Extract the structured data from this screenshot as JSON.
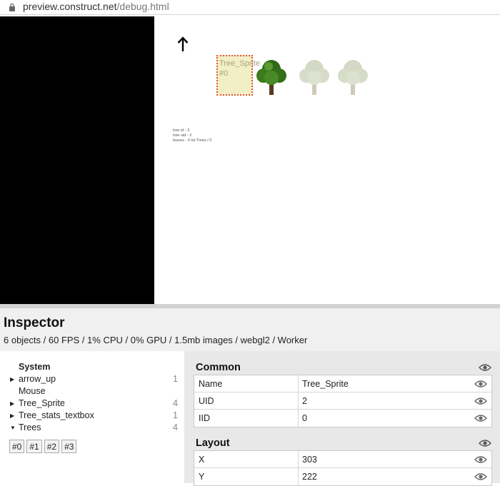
{
  "address_bar": {
    "host": "preview.construct.net",
    "path": "/debug.html"
  },
  "viewport": {
    "selected_sprite": {
      "name": "Tree_Sprite",
      "iid": "#0"
    },
    "stats_lines": [
      "tree id - 3",
      "tree uid - 2",
      "leaves - 0 tot Trees / 0"
    ]
  },
  "inspector": {
    "title": "Inspector",
    "stats": "6 objects / 60 FPS / 1% CPU / 0% GPU / 1.5mb images / webgl2 / Worker",
    "objects": {
      "system_label": "System",
      "items": [
        {
          "name": "arrow_up",
          "count": "1"
        },
        {
          "name": "Mouse",
          "count": ""
        },
        {
          "name": "Tree_Sprite",
          "count": "4"
        },
        {
          "name": "Tree_stats_textbox",
          "count": "1"
        },
        {
          "name": "Trees",
          "count": "4"
        }
      ],
      "instances": [
        "#0",
        "#1",
        "#2",
        "#3"
      ]
    },
    "common": {
      "title": "Common",
      "rows": [
        {
          "key": "Name",
          "value": "Tree_Sprite"
        },
        {
          "key": "UID",
          "value": "2"
        },
        {
          "key": "IID",
          "value": "0"
        }
      ]
    },
    "layout": {
      "title": "Layout",
      "rows": [
        {
          "key": "X",
          "value": "303"
        },
        {
          "key": "Y",
          "value": "222"
        }
      ]
    }
  },
  "colors": {
    "selection_border": "#e0533a",
    "tree_green": "#3c7a1e",
    "faded_tree": "#c9d3b4"
  },
  "icons": [
    "lock-icon",
    "arrow-up-icon",
    "tree-icon",
    "eye-icon",
    "caret-right-icon",
    "caret-down-icon"
  ]
}
